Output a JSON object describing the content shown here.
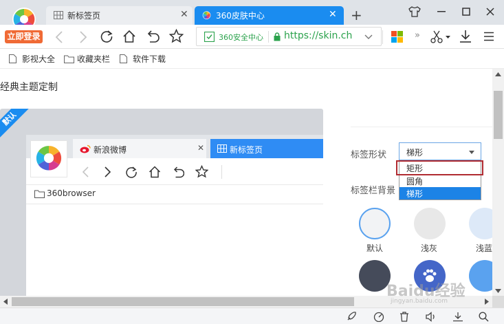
{
  "browser": {
    "login_button": "立即登录",
    "tabs": [
      {
        "label": "新标签页",
        "active": false
      },
      {
        "label": "360皮肤中心",
        "active": true
      }
    ],
    "new_tab_glyph": "+",
    "security_label": "360安全中心",
    "url": "https://skin.ch",
    "bookmarks": [
      "影视大全",
      "收藏夹栏",
      "软件下载"
    ],
    "icons": [
      "shirt-icon",
      "minimize-icon",
      "maximize-icon",
      "close-icon",
      "back-icon",
      "forward-icon",
      "reload-icon",
      "home-icon",
      "undo-icon",
      "star-icon",
      "shield-icon",
      "lock-icon",
      "chevron-down-icon",
      "apps-icon",
      "more-icon",
      "scissors-icon",
      "download-icon",
      "menu-icon"
    ]
  },
  "page": {
    "heading": "经典主题定制",
    "preview": {
      "corner_badge": "默认",
      "tabs": [
        {
          "label": "新浪微博"
        },
        {
          "label": "新标签页"
        }
      ],
      "bookmark": "360browser"
    },
    "options": {
      "tab_shape_label": "标签形状",
      "tab_shape_value": "梯形",
      "tab_shape_options": [
        "矩形",
        "圆角",
        "梯形"
      ],
      "selected_option": "梯形",
      "highlighted_option": "矩形",
      "tabbar_bg_label": "标签栏背景",
      "swatches": [
        {
          "label": "默认",
          "color": "#f2f3f5",
          "selected": true
        },
        {
          "label": "浅灰",
          "color": "#e8e8e8",
          "selected": false
        },
        {
          "label": "浅蓝",
          "color": "#dde9f8",
          "selected": false
        },
        {
          "label": "",
          "color": "#454b5a",
          "selected": false
        },
        {
          "label": "",
          "color": "#4466c8",
          "selected": false
        },
        {
          "label": "",
          "color": "#5aa2ef",
          "selected": false
        }
      ]
    }
  },
  "watermark": {
    "text": "Baidu经验",
    "subtext": "jingyan.baidu.com"
  },
  "colors": {
    "accent": "#1a8cf0",
    "login": "#f06a35",
    "highlight_border": "#b02a30",
    "selected_bg": "#1c83e6"
  }
}
